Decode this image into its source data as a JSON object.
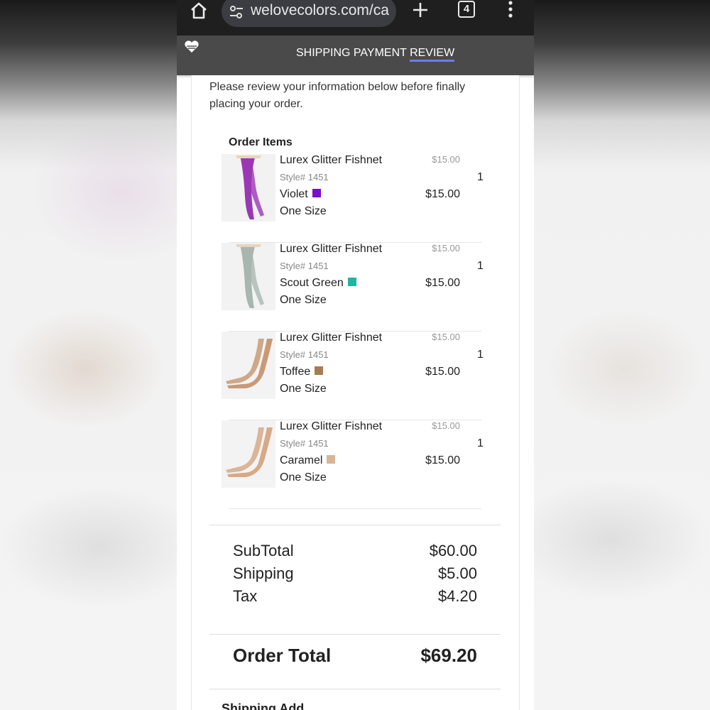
{
  "browser": {
    "url": "welovecolors.com/ca",
    "tab_count": "4"
  },
  "checkout_steps": [
    "SHIPPING",
    "PAYMENT",
    "REVIEW"
  ],
  "active_step": "REVIEW",
  "intro_text": "Please review your information below before finally placing your order.",
  "order_items_title": "Order Items",
  "items": [
    {
      "name": "Lurex Glitter Fishnet",
      "style": "Style# 1451",
      "color": "Violet",
      "swatch": "#7b0fc6",
      "size": "One Size",
      "unit_price": "$15.00",
      "line_price": "$15.00",
      "qty": "1",
      "thumb_color": "#9b37b5",
      "thumb_bg": "#f2f2f2"
    },
    {
      "name": "Lurex Glitter Fishnet",
      "style": "Style# 1451",
      "color": "Scout Green",
      "swatch": "#21b3a3",
      "size": "One Size",
      "unit_price": "$15.00",
      "line_price": "$15.00",
      "qty": "1",
      "thumb_color": "#a7b7b0",
      "thumb_bg": "#f2f2f2"
    },
    {
      "name": "Lurex Glitter Fishnet",
      "style": "Style# 1451",
      "color": "Toffee",
      "swatch": "#a67c52",
      "size": "One Size",
      "unit_price": "$15.00",
      "line_price": "$15.00",
      "qty": "1",
      "thumb_color": "#c89a76",
      "thumb_bg": "#f3f3f3"
    },
    {
      "name": "Lurex Glitter Fishnet",
      "style": "Style# 1451",
      "color": "Caramel",
      "swatch": "#d8b596",
      "size": "One Size",
      "unit_price": "$15.00",
      "line_price": "$15.00",
      "qty": "1",
      "thumb_color": "#d6a987",
      "thumb_bg": "#f3f3f3"
    }
  ],
  "summary": {
    "subtotal_label": "SubTotal",
    "subtotal": "$60.00",
    "shipping_label": "Shipping",
    "shipping": "$5.00",
    "tax_label": "Tax",
    "tax": "$4.20",
    "total_label": "Order Total",
    "total": "$69.20"
  },
  "next_section_partial": "Shipping Add..."
}
